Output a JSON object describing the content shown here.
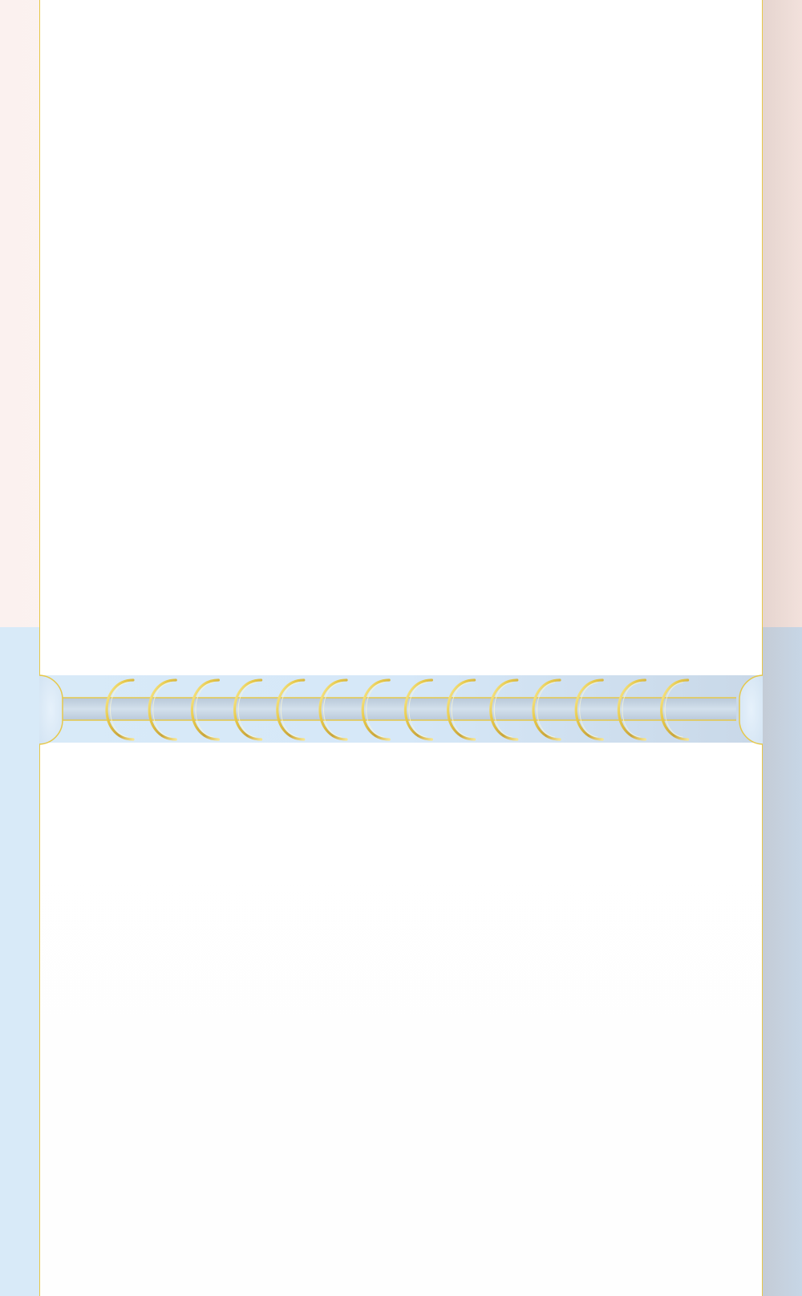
{
  "notebook": {
    "theme_colors": {
      "top_background": "#fbf1ef",
      "bottom_background": "#d8eaf8",
      "page": "#ffffff",
      "gold_border": "#e6c84a",
      "binding_bar": "#c8d6e4"
    },
    "ring_count": 14,
    "ring_icon": "spiral-ring-icon"
  }
}
